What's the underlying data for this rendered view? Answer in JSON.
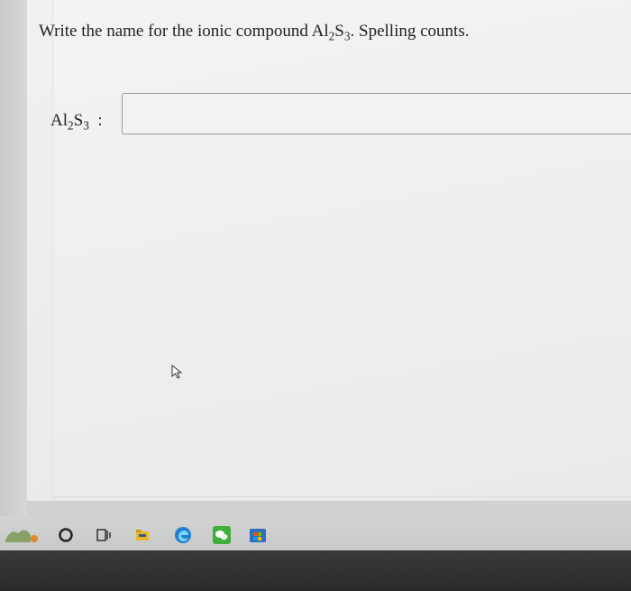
{
  "question": {
    "prefix": "Write the name for the ionic compound ",
    "formula_el1": "Al",
    "formula_sub1": "2",
    "formula_el2": "S",
    "formula_sub2": "3",
    "suffix": ". Spelling counts."
  },
  "answer": {
    "label_el1": "Al",
    "label_sub1": "2",
    "label_el2": "S",
    "label_sub2": "3",
    "label_colon": ":",
    "value": "",
    "placeholder": ""
  },
  "taskbar": {
    "items": [
      {
        "icon": "weather-icon"
      },
      {
        "icon": "search-circle-icon"
      },
      {
        "icon": "task-view-icon"
      },
      {
        "icon": "file-explorer-icon"
      },
      {
        "icon": "edge-icon"
      },
      {
        "icon": "wechat-icon"
      },
      {
        "icon": "store-icon"
      }
    ]
  },
  "colors": {
    "accent_edge": "#1f7fd1",
    "wechat_green": "#3fae3a",
    "store_blue": "#2f6fc0",
    "folder_yellow": "#e7b82c"
  }
}
